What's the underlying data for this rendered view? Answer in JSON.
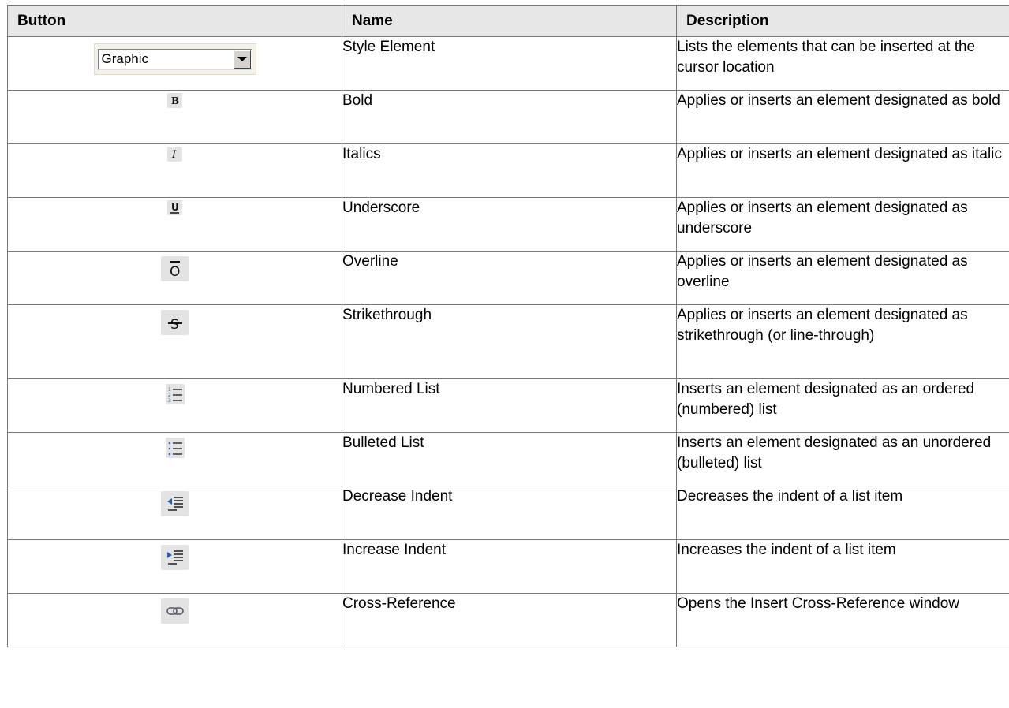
{
  "table": {
    "headers": [
      "Button",
      "Name",
      "Description"
    ],
    "rows": [
      {
        "icon": "style-element-dropdown",
        "combo_value": "Graphic",
        "name": "Style Element",
        "description": "Lists the elements that can be inserted at the cursor location"
      },
      {
        "icon": "bold-icon",
        "name": "Bold",
        "description": "Applies or inserts an element designated as bold"
      },
      {
        "icon": "italic-icon",
        "name": "Italics",
        "description": "Applies or inserts an element designated as italic"
      },
      {
        "icon": "underline-icon",
        "name": "Underscore",
        "description": "Applies or inserts an element designated as underscore"
      },
      {
        "icon": "overline-icon",
        "name": "Overline",
        "description": "Applies or inserts an element designated as overline"
      },
      {
        "icon": "strikethrough-icon",
        "name": "Strikethrough",
        "description": "Applies or inserts an element designated as strikethrough (or line-through)"
      },
      {
        "icon": "numbered-list-icon",
        "name": "Numbered List",
        "description": "Inserts an element designated as an ordered (numbered) list"
      },
      {
        "icon": "bulleted-list-icon",
        "name": "Bulleted List",
        "description": "Inserts an element designated as an unordered (bulleted) list"
      },
      {
        "icon": "decrease-indent-icon",
        "name": "Decrease Indent",
        "description": "Decreases the indent of a list item"
      },
      {
        "icon": "increase-indent-icon",
        "name": "Increase Indent",
        "description": "Increases the indent of a list item"
      },
      {
        "icon": "cross-reference-icon",
        "name": "Cross-Reference",
        "description": "Opens the Insert Cross-Reference window"
      }
    ]
  },
  "colors": {
    "border": "#777777",
    "header_background": "#e7e7e7",
    "icon_background": "#e3e3e3",
    "indent_arrow_blue": "#2d5fb3"
  }
}
